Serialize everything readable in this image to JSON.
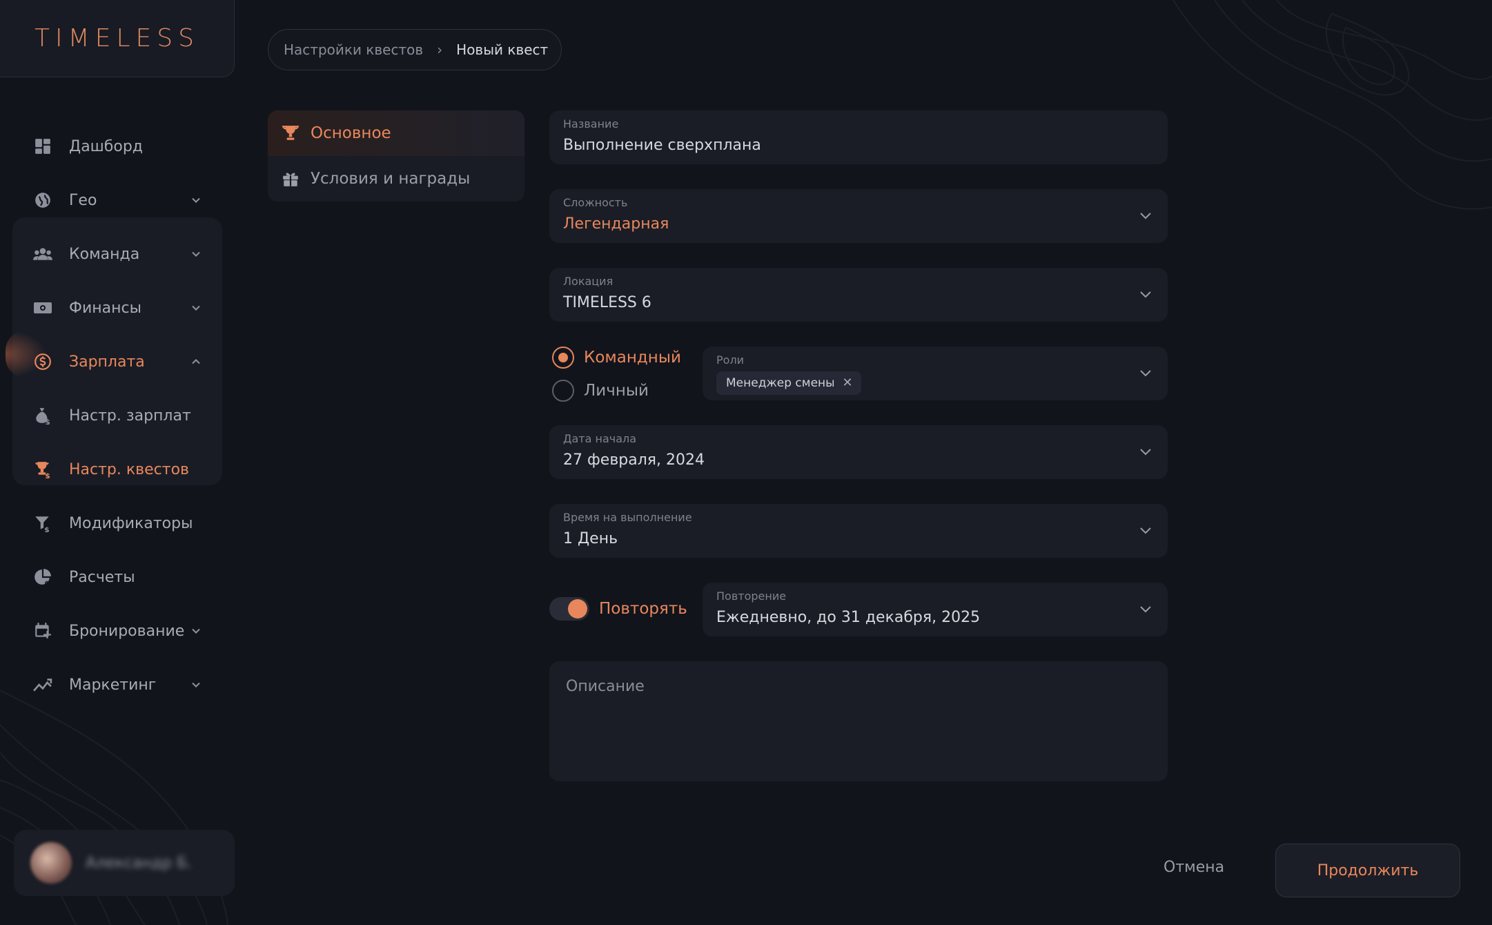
{
  "brand": {
    "logo": "TIMELESS",
    "accent": "#e8875c"
  },
  "breadcrumb": {
    "parent": "Настройки квестов",
    "separator": "›",
    "current": "Новый квест"
  },
  "sidebar": {
    "items": [
      {
        "label": "Дашборд",
        "icon": "dashboard-icon",
        "expandable": false
      },
      {
        "label": "Гео",
        "icon": "globe-icon",
        "expandable": true
      },
      {
        "label": "Команда",
        "icon": "team-icon",
        "expandable": true
      },
      {
        "label": "Финансы",
        "icon": "money-icon",
        "expandable": true
      },
      {
        "label": "Зарплата",
        "icon": "dollar-circle-icon",
        "expandable": true,
        "expanded": true
      },
      {
        "label": "Настр. зарплат",
        "icon": "money-bag-icon",
        "sub": true
      },
      {
        "label": "Настр. квестов",
        "icon": "trophy-dollar-icon",
        "sub": true,
        "active": true
      },
      {
        "label": "Модификаторы",
        "icon": "filter-dollar-icon",
        "sub": true
      },
      {
        "label": "Расчеты",
        "icon": "pie-chart-icon",
        "sub": true
      },
      {
        "label": "Бронирование",
        "icon": "calendar-plus-icon",
        "expandable": true
      },
      {
        "label": "Маркетинг",
        "icon": "trend-icon",
        "expandable": true
      }
    ]
  },
  "user": {
    "name": "Александр Б."
  },
  "tabs": [
    {
      "label": "Основное",
      "icon": "trophy-icon",
      "active": true
    },
    {
      "label": "Условия и награды",
      "icon": "gift-icon",
      "active": false
    }
  ],
  "form": {
    "name": {
      "label": "Название",
      "value": "Выполнение сверхплана"
    },
    "difficulty": {
      "label": "Сложность",
      "value": "Легендарная"
    },
    "location": {
      "label": "Локация",
      "value": "TIMELESS 6"
    },
    "type": {
      "options": [
        "Командный",
        "Личный"
      ],
      "selected": "Командный"
    },
    "roles": {
      "label": "Роли",
      "chip": "Менеджер смены",
      "chip_remove": "✕"
    },
    "start_date": {
      "label": "Дата начала",
      "value": "27 февраля, 2024"
    },
    "duration": {
      "label": "Время на выполнение",
      "value": "1 День"
    },
    "repeat_toggle": {
      "label": "Повторять",
      "on": true
    },
    "repetition": {
      "label": "Повторение",
      "value": "Ежедневно, до 31 декабря, 2025"
    },
    "description": {
      "placeholder": "Описание"
    }
  },
  "actions": {
    "cancel": "Отмена",
    "continue": "Продолжить"
  }
}
